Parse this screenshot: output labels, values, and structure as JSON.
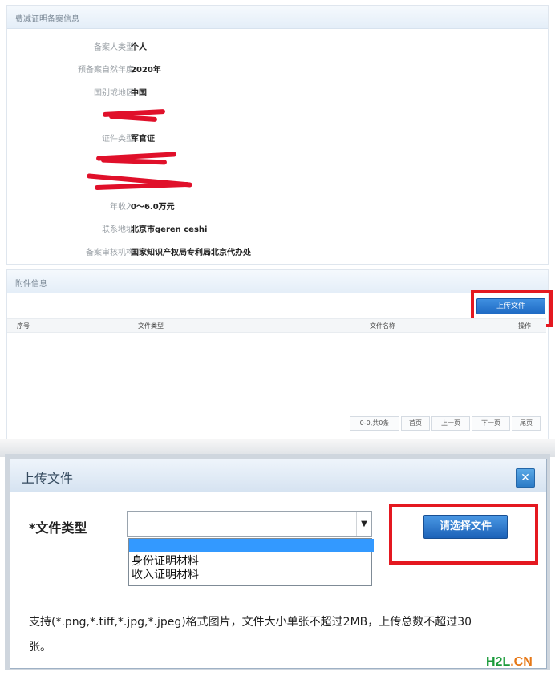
{
  "filing_panel": {
    "title": "费减证明备案信息",
    "rows": [
      {
        "label": "备案人类型：",
        "value": "个人"
      },
      {
        "label": "预备案自然年度：",
        "value": "2020年"
      },
      {
        "label": "国别或地区：",
        "value": "中国"
      },
      {
        "label": "证件类型：",
        "value": "军官证"
      },
      {
        "label": "年收入：",
        "value": "0～6.0万元"
      },
      {
        "label": "联系地址：",
        "value": "北京市geren ceshi"
      },
      {
        "label": "备案审核机构：",
        "value": "国家知识产权局专利局北京代办处"
      }
    ]
  },
  "attachment_panel": {
    "title": "附件信息",
    "upload_button": "上传文件",
    "columns": [
      "序号",
      "文件类型",
      "文件名称",
      "操作"
    ],
    "pager": {
      "summary": "0-0,共0条",
      "first": "首页",
      "prev": "上一页",
      "next": "下一页",
      "last": "尾页"
    }
  },
  "dialog": {
    "title": "上传文件",
    "close_icon": "close-icon",
    "file_type_label": "*文件类型",
    "select_value": "",
    "options": [
      "",
      "身份证明材料",
      "收入证明材料"
    ],
    "choose_button": "请选择文件",
    "tip_line1": "支持(*.png,*.tiff,*.jpg,*.jpeg)格式图片，文件大小单张不超过2MB，上传总数不超过30",
    "tip_line2": "张。"
  },
  "watermark": {
    "part1": "H2L",
    "part2": ".CN"
  },
  "colors": {
    "accent": "#1e6ac4",
    "highlight": "#e41820",
    "selected_option": "#3399ff"
  }
}
